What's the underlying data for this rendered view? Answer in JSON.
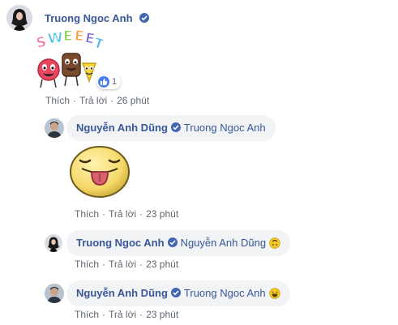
{
  "comment": {
    "author": "Truong Ngoc Anh",
    "reaction_count": "1",
    "actions": {
      "like": "Thích",
      "reply": "Trả lời",
      "time": "26 phút"
    }
  },
  "replies": [
    {
      "author": "Nguyễn Anh Dũng",
      "mention": "Truong Ngoc Anh",
      "actions": {
        "like": "Thích",
        "reply": "Trả lời",
        "time": "23 phút"
      }
    },
    {
      "author": "Truong Ngoc Anh",
      "mention": "Nguyễn Anh Dũng",
      "actions": {
        "like": "Thích",
        "reply": "Trả lời",
        "time": "23 phút"
      }
    },
    {
      "author": "Nguyễn Anh Dũng",
      "mention": "Truong Ngoc Anh",
      "actions": {
        "like": "Thích",
        "reply": "Trả lời",
        "time": "23 phút"
      }
    }
  ],
  "icons": {
    "verified": "verified-badge-icon",
    "like": "like-reaction-icon",
    "sticker_sweet": "SWEEET",
    "sticker_tongue": "tongue-face-sticker",
    "emoji_upside_down": "upside-down-face",
    "emoji_laughing": "laughing-face"
  },
  "colors": {
    "name": "#385898",
    "bubble": "#f2f3f5",
    "meta": "#606770",
    "badge": "#4267b2"
  }
}
